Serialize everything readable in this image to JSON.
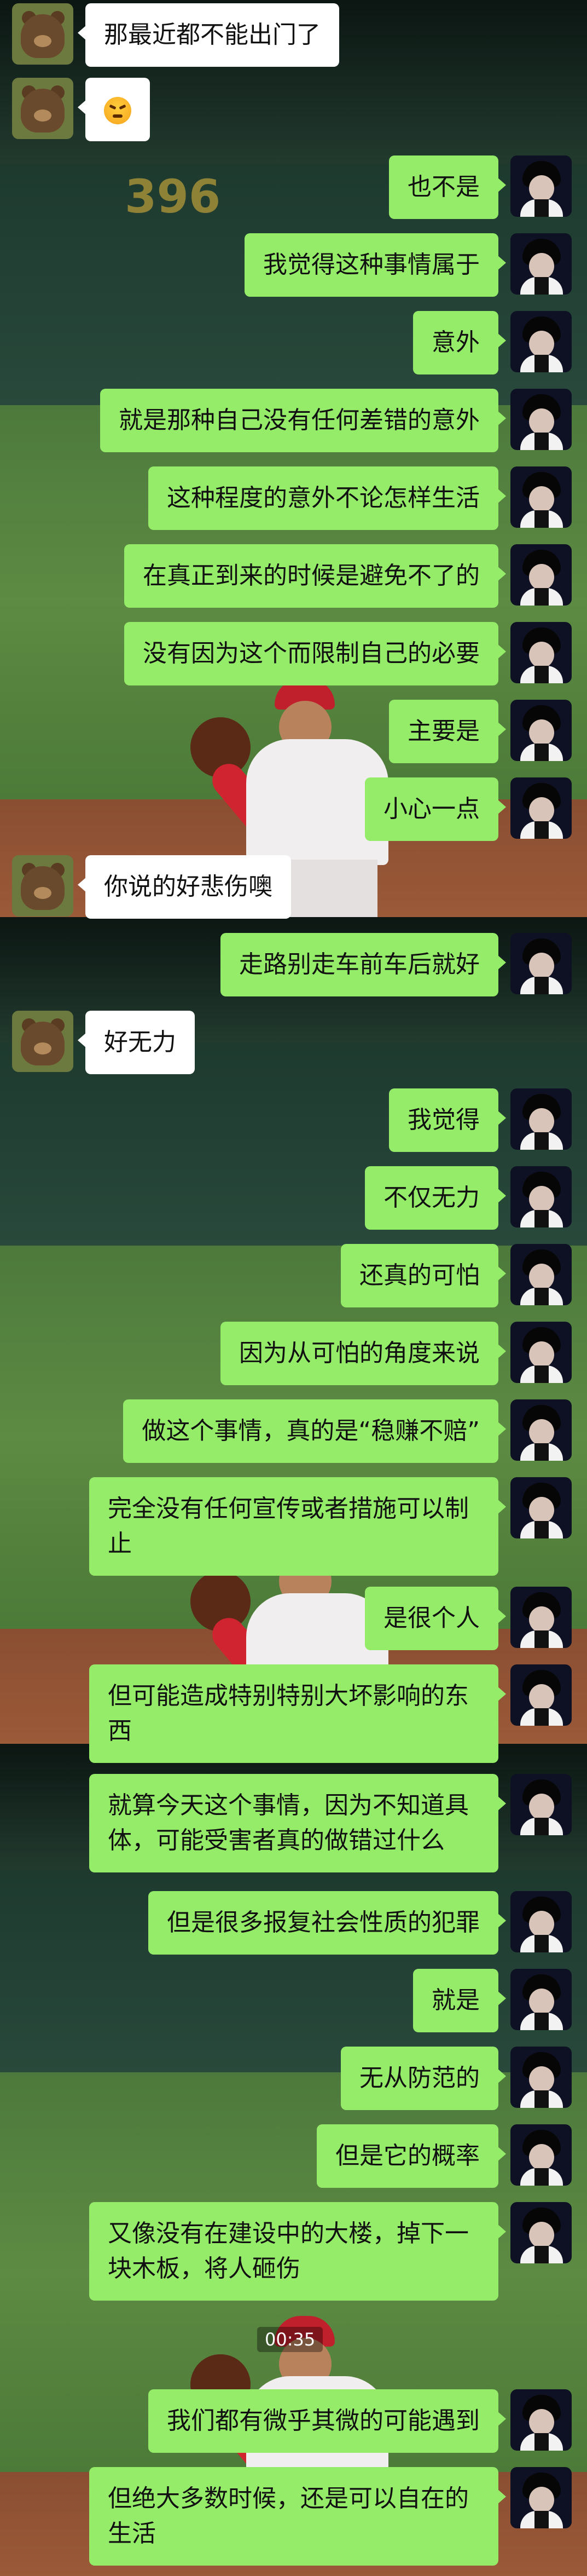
{
  "theme": {
    "bubble_self": "#95ec69",
    "bubble_other": "#ffffff"
  },
  "timestamp": "00:35",
  "avatars": {
    "other": "bear-avatar",
    "self": "person-avatar"
  },
  "messages": [
    {
      "side": "left",
      "text": "那最近都不能出门了"
    },
    {
      "side": "left",
      "text": "",
      "emoji": "angry-face-emoji"
    },
    {
      "side": "right",
      "text": "也不是"
    },
    {
      "side": "right",
      "text": "我觉得这种事情属于"
    },
    {
      "side": "right",
      "text": "意外"
    },
    {
      "side": "right",
      "text": "就是那种自己没有任何差错的意外"
    },
    {
      "side": "right",
      "text": "这种程度的意外不论怎样生活"
    },
    {
      "side": "right",
      "text": "在真正到来的时候是避免不了的"
    },
    {
      "side": "right",
      "text": "没有因为这个而限制自己的必要"
    },
    {
      "side": "right",
      "text": "主要是"
    },
    {
      "side": "right",
      "text": "小心一点"
    },
    {
      "side": "left",
      "text": "你说的好悲伤噢"
    },
    {
      "side": "right",
      "text": "走路别走车前车后就好"
    },
    {
      "side": "left",
      "text": "好无力"
    },
    {
      "side": "right",
      "text": "我觉得"
    },
    {
      "side": "right",
      "text": "不仅无力"
    },
    {
      "side": "right",
      "text": "还真的可怕"
    },
    {
      "side": "right",
      "text": "因为从可怕的角度来说"
    },
    {
      "side": "right",
      "text": "做这个事情，真的是“稳赚不赔”"
    },
    {
      "side": "right",
      "text": "完全没有任何宣传或者措施可以制止"
    },
    {
      "side": "right",
      "text": "是很个人"
    },
    {
      "side": "right",
      "text": "但可能造成特别特别大坏影响的东西"
    },
    {
      "side": "right",
      "text": "就算今天这个事情，因为不知道具体，可能受害者真的做错过什么"
    },
    {
      "side": "right",
      "text": "但是很多报复社会性质的犯罪"
    },
    {
      "side": "right",
      "text": "就是"
    },
    {
      "side": "right",
      "text": "无从防范的"
    },
    {
      "side": "right",
      "text": "但是它的概率"
    },
    {
      "side": "right",
      "text": "又像没有在建设中的大楼，掉下一块木板，将人砸伤"
    },
    {
      "side": "right",
      "text": "我们都有微乎其微的可能遇到"
    },
    {
      "side": "right",
      "text": "但绝大多数时候，还是可以自在的生活"
    }
  ]
}
